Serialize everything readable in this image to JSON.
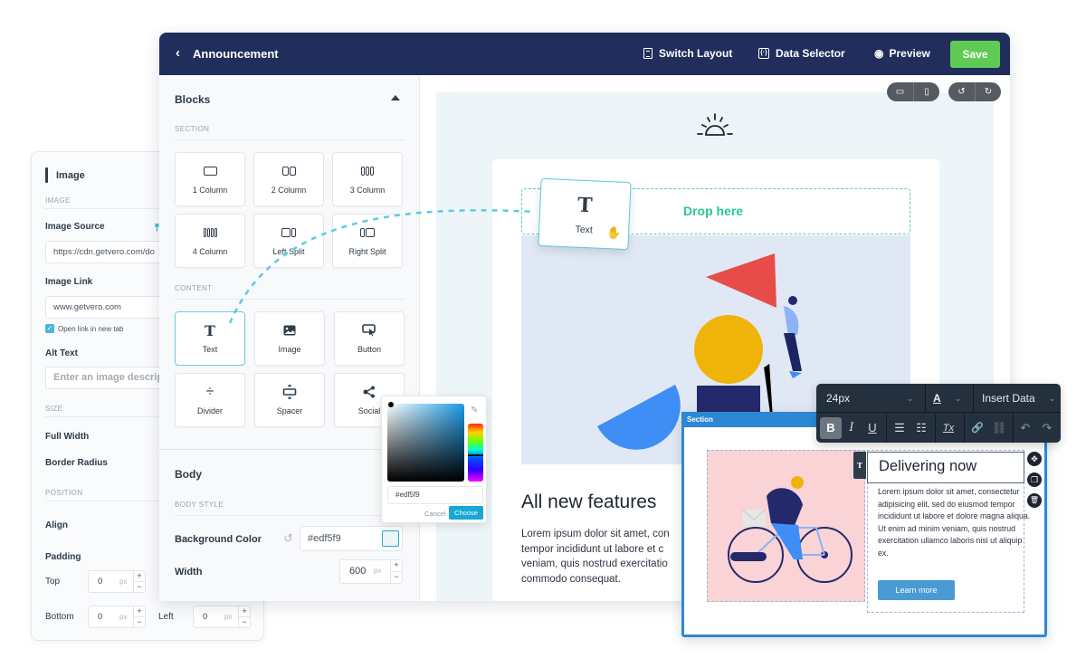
{
  "image_panel": {
    "title": "Image",
    "section_image": "IMAGE",
    "image_source_label": "Image Source",
    "image_source_value": "https://cdn.getvero.com/do",
    "image_link_label": "Image Link",
    "image_link_value": "www.getvero.com",
    "open_new_tab_label": "Open link in new tab",
    "open_new_tab_checked": true,
    "alt_text_label": "Alt Text",
    "alt_text_placeholder": "Enter an image description",
    "section_size": "SIZE",
    "full_width_label": "Full Width",
    "border_radius_label": "Border Radius",
    "section_position": "POSITION",
    "align_label": "Align",
    "padding_label": "Padding",
    "top_label": "Top",
    "top_value": "0",
    "bottom_label": "Bottom",
    "bottom_value": "0",
    "left_label": "Left",
    "left_value": "0",
    "unit": "px",
    "plus": "+",
    "minus": "−"
  },
  "topbar": {
    "back_icon": "‹",
    "title": "Announcement",
    "switch_layout": "Switch Layout",
    "data_selector": "Data Selector",
    "data_selector_icon": "{·}",
    "preview": "Preview",
    "preview_icon": "◉",
    "save": "Save"
  },
  "sidebar": {
    "blocks_title": "Blocks",
    "section_label": "SECTION",
    "section_blocks": [
      {
        "label": "1 Column"
      },
      {
        "label": "2 Column"
      },
      {
        "label": "3 Column"
      },
      {
        "label": "4 Column"
      },
      {
        "label": "Left Split"
      },
      {
        "label": "Right Split"
      }
    ],
    "content_label": "CONTENT",
    "content_blocks": [
      {
        "label": "Text",
        "icon": "T"
      },
      {
        "label": "Image"
      },
      {
        "label": "Button"
      },
      {
        "label": "Divider",
        "icon": "÷"
      },
      {
        "label": "Spacer"
      },
      {
        "label": "Social"
      }
    ],
    "body_title": "Body",
    "body_style_label": "BODY STYLE",
    "bg_color_label": "Background Color",
    "bg_color_value": "#edf5f9",
    "reset_icon": "↺",
    "width_label": "Width",
    "width_value": "600",
    "unit": "px",
    "plus": "+",
    "minus": "−"
  },
  "canvas": {
    "view_toggle": {
      "desktop": "▭",
      "mobile": "▯"
    },
    "history": {
      "undo": "↺",
      "redo": "↻"
    },
    "drop_here": "Drop here",
    "heading": "All new features",
    "paragraph_lines": [
      "Lorem ipsum dolor sit amet, con",
      "tempor incididunt ut labore et c",
      "veniam, quis nostrud exercitatio",
      "commodo consequat."
    ],
    "background_color": "#edf5f9"
  },
  "drag_ghost": {
    "icon": "T",
    "label": "Text",
    "cursor_icon": "✋"
  },
  "color_picker": {
    "hex": "#edf5f9",
    "cancel": "Cancel",
    "choose": "Choose",
    "eyedropper_icon": "✎"
  },
  "section_popup": {
    "tab_label": "Section",
    "t_badge": "T",
    "heading": "Delivering now",
    "paragraph": "Lorem ipsum dolor sit amet, consectetur adipisicing elit, sed do eiusmod tempor incididunt ut labore et dolore magna aliqua. Ut enim ad minim veniam, quis nostrud exercitation ullamco laboris nisi ut aliquip ex.",
    "button": "Learn more",
    "actions": {
      "move": "✥",
      "duplicate": "❐",
      "delete": "🗑"
    }
  },
  "rte_toolbar": {
    "font_size": "24px",
    "color_label": "A",
    "insert_data": "Insert Data",
    "chevron": "⌄",
    "bold": "B",
    "italic": "I",
    "underline": "U",
    "ordered_list": "☰",
    "bullet_list": "☷",
    "clear_format": "Tx",
    "link": "🔗",
    "unlink": "⛓",
    "undo": "↶",
    "redo": "↷"
  }
}
